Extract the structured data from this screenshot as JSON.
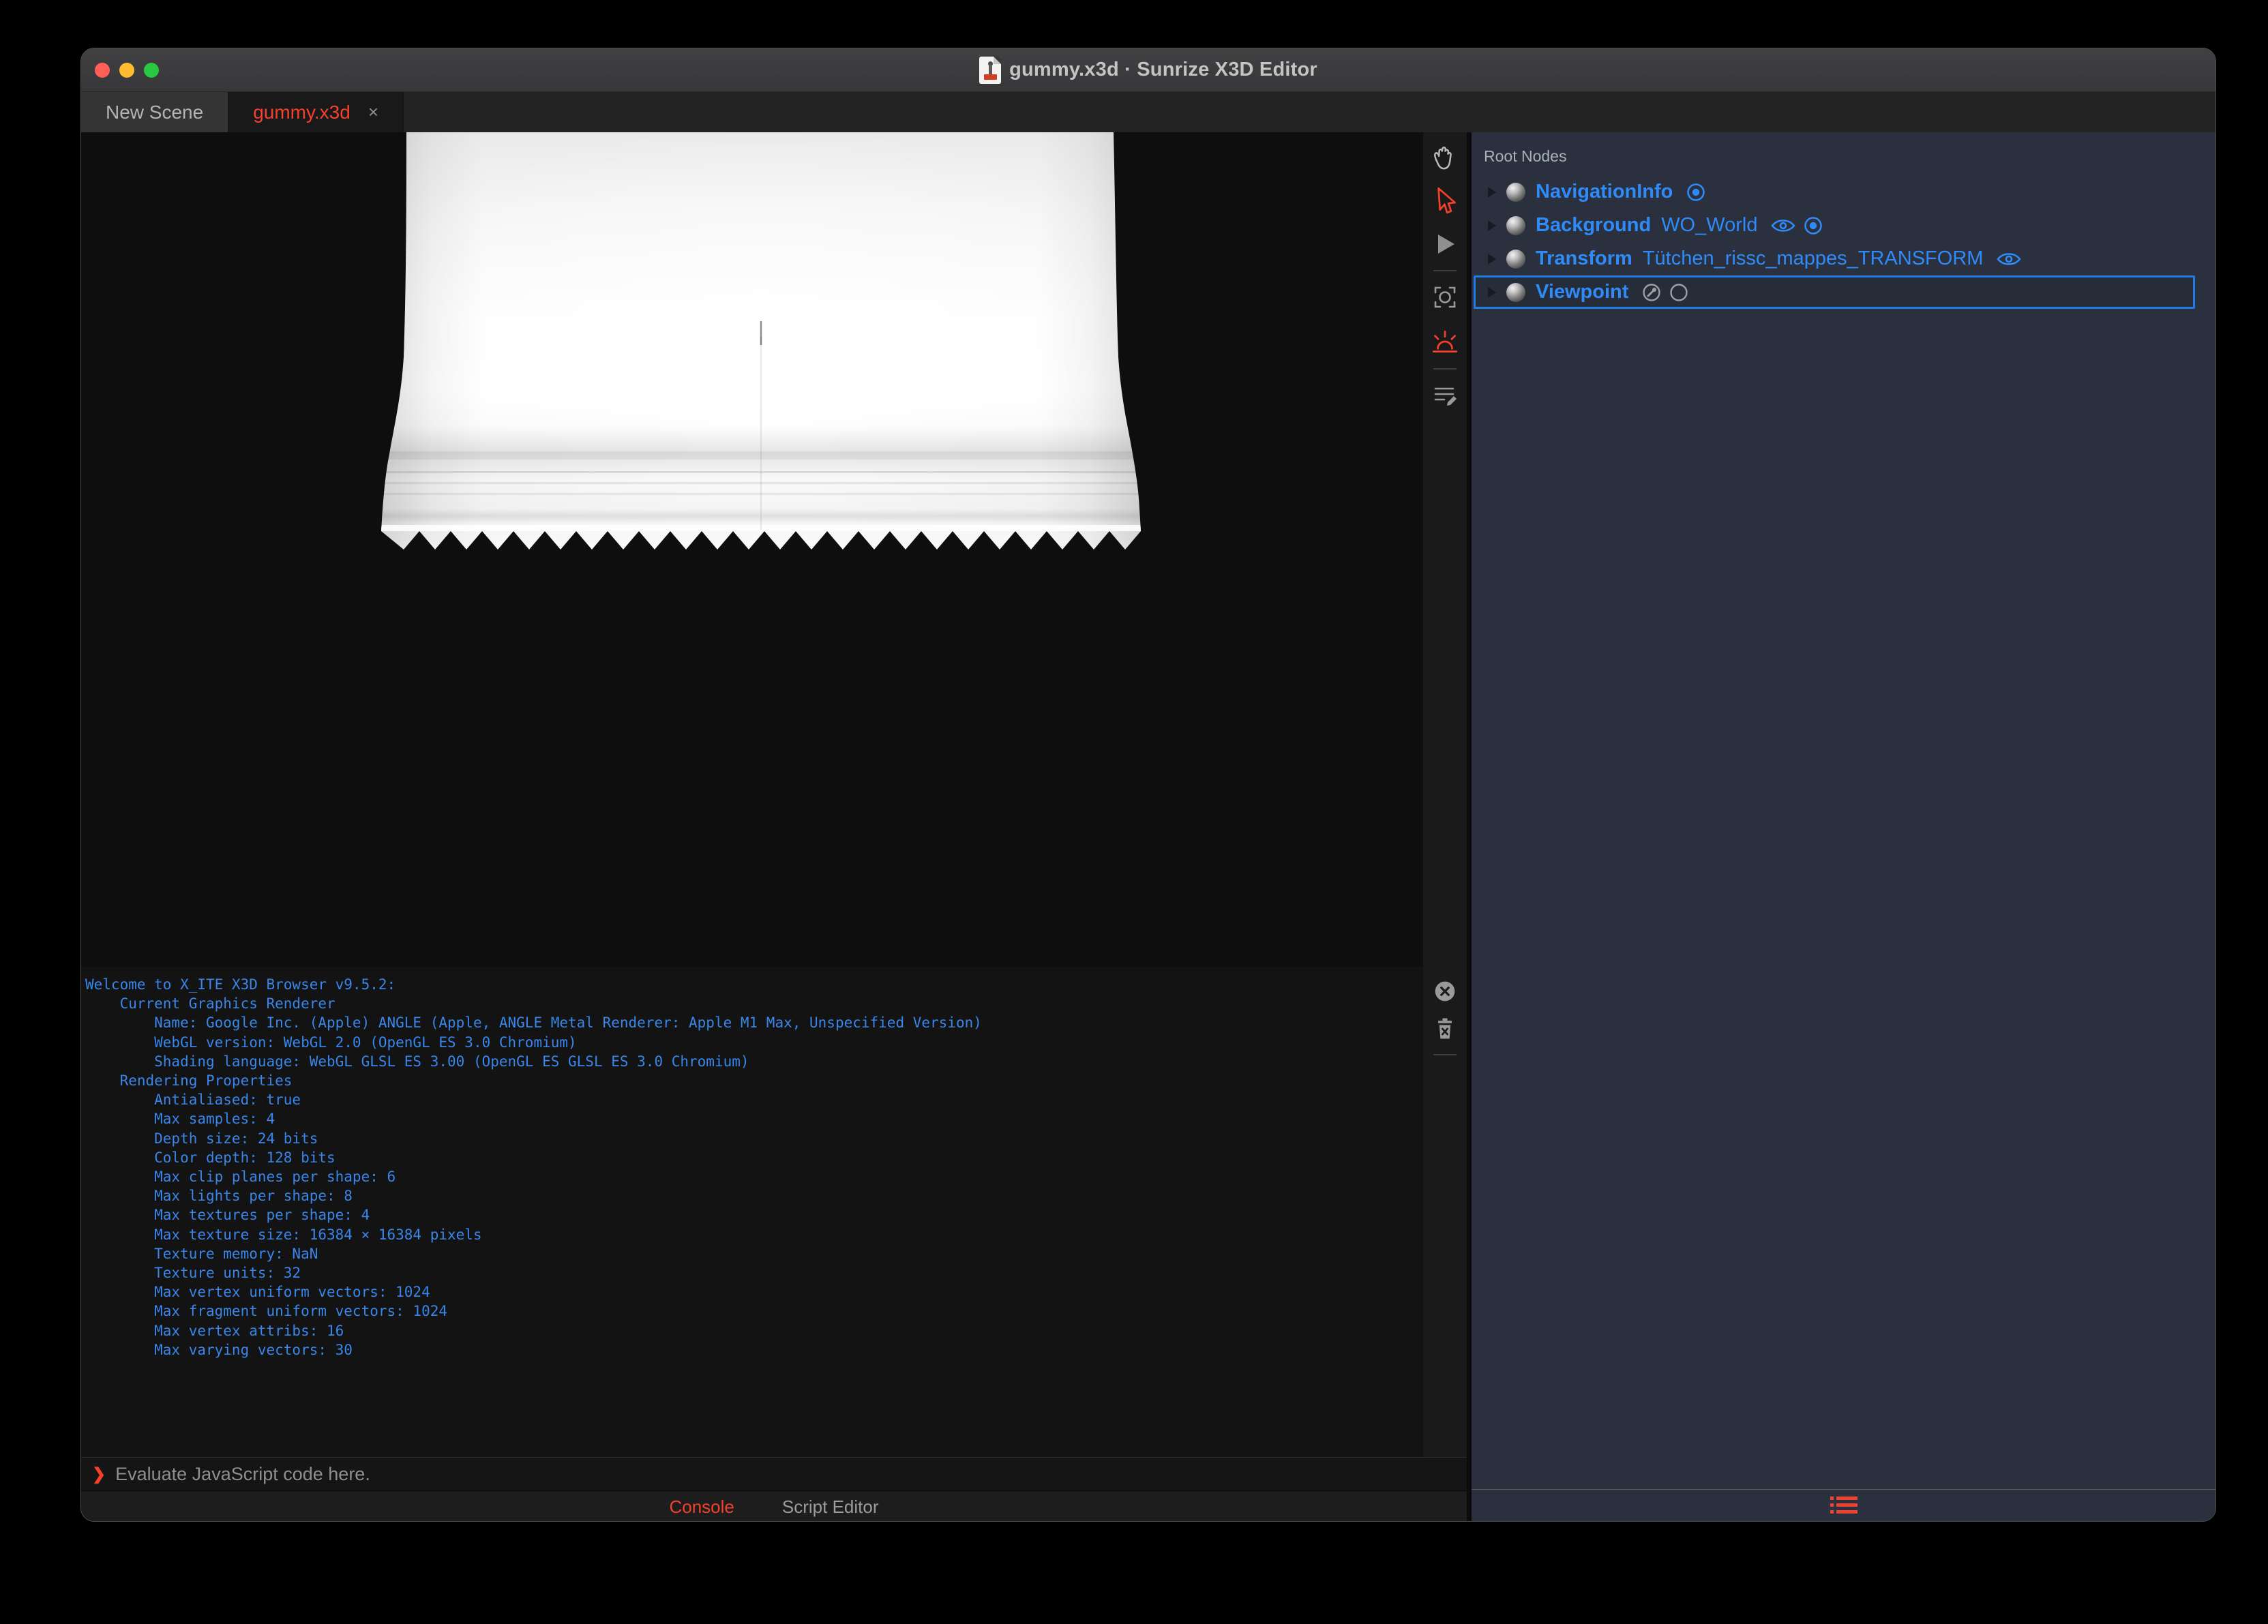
{
  "titlebar": {
    "title": "gummy.x3d · Sunrize X3D Editor"
  },
  "tabs": {
    "new_scene_label": "New Scene",
    "active_label": "gummy.x3d",
    "close_glyph": "×"
  },
  "toolbar": {
    "tools": [
      "pan-hand",
      "select-arrow",
      "play",
      "frame-capture",
      "sunrise-light",
      "script-edit"
    ],
    "console_tools": [
      "close",
      "clear-trash"
    ]
  },
  "viewport": {
    "model": "white gummy bag with serrated bottom edge"
  },
  "console": {
    "lines": [
      "Welcome to X_ITE X3D Browser v9.5.2:",
      "    Current Graphics Renderer",
      "        Name: Google Inc. (Apple) ANGLE (Apple, ANGLE Metal Renderer: Apple M1 Max, Unspecified Version)",
      "        WebGL version: WebGL 2.0 (OpenGL ES 3.0 Chromium)",
      "        Shading language: WebGL GLSL ES 3.00 (OpenGL ES GLSL ES 3.0 Chromium)",
      "    Rendering Properties",
      "        Antialiased: true",
      "        Max samples: 4",
      "        Depth size: 24 bits",
      "        Color depth: 128 bits",
      "        Max clip planes per shape: 6",
      "        Max lights per shape: 8",
      "        Max textures per shape: 4",
      "        Max texture size: 16384 × 16384 pixels",
      "        Texture memory: NaN",
      "        Texture units: 32",
      "        Max vertex uniform vectors: 1024",
      "        Max fragment uniform vectors: 1024",
      "        Max vertex attribs: 16",
      "        Max varying vectors: 30"
    ],
    "prompt_chevron": "❯",
    "prompt_placeholder": "Evaluate JavaScript code here."
  },
  "bottom_bar": {
    "console_label": "Console",
    "script_editor_label": "Script Editor"
  },
  "outline": {
    "header": "Root Nodes",
    "nodes": [
      {
        "type": "NavigationInfo",
        "name": ""
      },
      {
        "type": "Background",
        "name": "WO_World"
      },
      {
        "type": "Transform",
        "name": "Tütchen_rissc_mappes_TRANSFORM"
      },
      {
        "type": "Viewpoint",
        "name": ""
      }
    ]
  },
  "colors": {
    "accent_red": "#f5402c",
    "node_blue": "#2f8bf9",
    "console_blue": "#3986ea",
    "selection_border": "#1e7ce6",
    "panel_bg": "#2a303d",
    "traffic_red": "#ff5f57",
    "traffic_yellow": "#febc2e",
    "traffic_green": "#28c840"
  }
}
